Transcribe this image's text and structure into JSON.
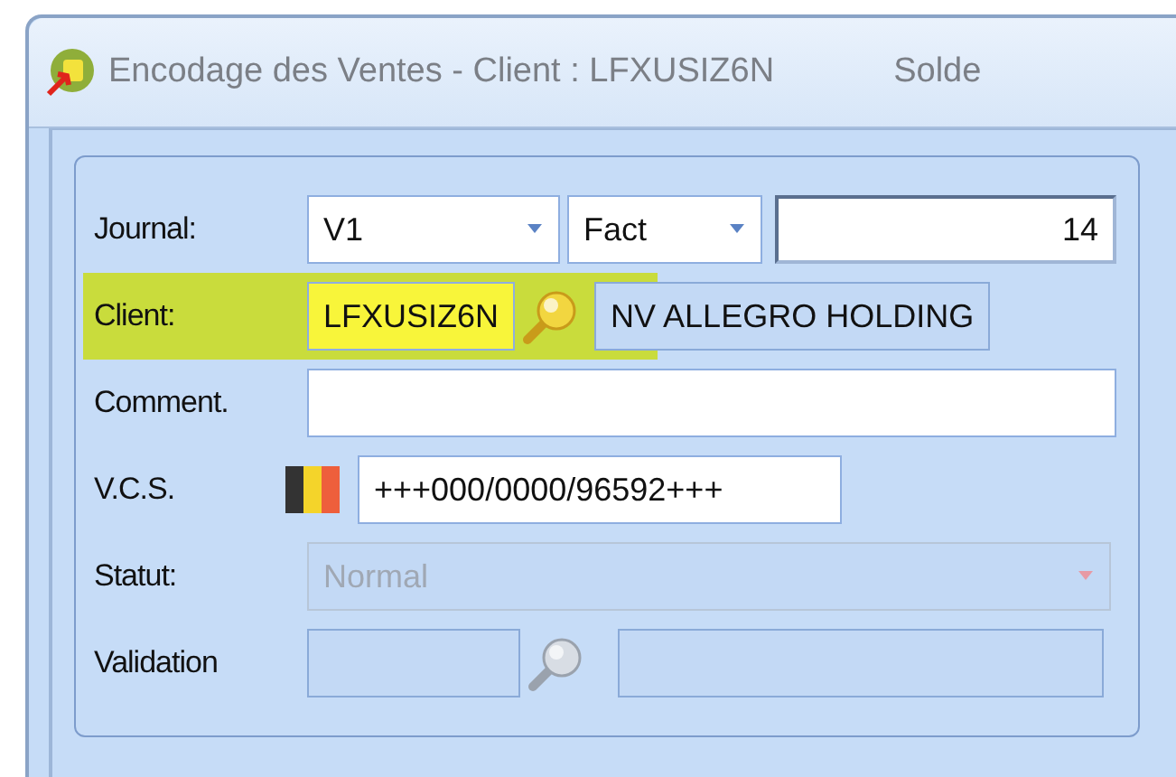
{
  "window": {
    "title": "Encodage des Ventes - Client : LFXUSIZ6N",
    "title_extra": "Solde"
  },
  "rows": [
    {
      "kind": "journal",
      "label": "Journal:",
      "journal": "V1",
      "type": "Fact",
      "number": "14"
    },
    {
      "kind": "client",
      "label": "Client:",
      "highlighted": true,
      "code": "LFXUSIZ6N",
      "name": "NV ALLEGRO HOLDING"
    },
    {
      "kind": "text",
      "label": "Comment."
    },
    {
      "kind": "vcs",
      "label": "V.C.S.",
      "value": "+++000/0000/96592+++"
    },
    {
      "kind": "select",
      "label": "Statut:",
      "value": "Normal",
      "disabled": true
    },
    {
      "kind": "lookup",
      "label": "Validation",
      "disabled": true
    }
  ]
}
